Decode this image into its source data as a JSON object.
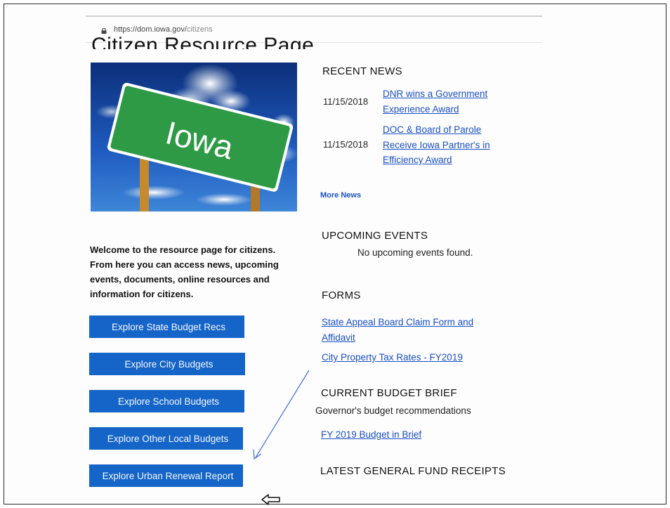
{
  "browser": {
    "url_host": "https://dom.iowa.gov/",
    "url_path": "citizens"
  },
  "page": {
    "title": "Citizen Resource Page",
    "hero_sign_text": "Iowa",
    "welcome_text": "Welcome to the resource page for citizens. From here you can access news, upcoming events, documents, online resources and information for citizens."
  },
  "buttons": [
    {
      "label": "Explore State Budget Recs"
    },
    {
      "label": "Explore City Budgets"
    },
    {
      "label": "Explore School Budgets"
    },
    {
      "label": "Explore Other Local Budgets"
    },
    {
      "label": "Explore Urban Renewal Report"
    }
  ],
  "recent_news": {
    "title": "RECENT NEWS",
    "items": [
      {
        "date": "11/15/2018",
        "line1": "DNR wins a Government",
        "line2": "Experience Award",
        "line3": ""
      },
      {
        "date": "11/15/2018",
        "line1": "DOC & Board of Parole",
        "line2": "Receive Iowa Partner's in",
        "line3": "Efficiency Award"
      }
    ],
    "more_label": "More News"
  },
  "upcoming_events": {
    "title": "UPCOMING EVENTS",
    "empty_text": "No upcoming events found."
  },
  "forms": {
    "title": "FORMS",
    "links": [
      {
        "line1": "State Appeal Board Claim Form and",
        "line2": "Affidavit"
      },
      {
        "line1": "City Property Tax Rates - FY2019",
        "line2": ""
      }
    ]
  },
  "budget_brief": {
    "title": "CURRENT BUDGET BRIEF",
    "subtitle": "Governor's budget recommendations",
    "link": "FY 2019 Budget in Brief"
  },
  "general_fund": {
    "title": "LATEST GENERAL FUND RECEIPTS"
  },
  "colors": {
    "button_bg": "#1565c8",
    "link": "#1a4fc4",
    "annotation_arrow": "#3a6fd0"
  },
  "icons": {
    "lock": "lock-icon",
    "back_arrow": "back-arrow-icon"
  }
}
